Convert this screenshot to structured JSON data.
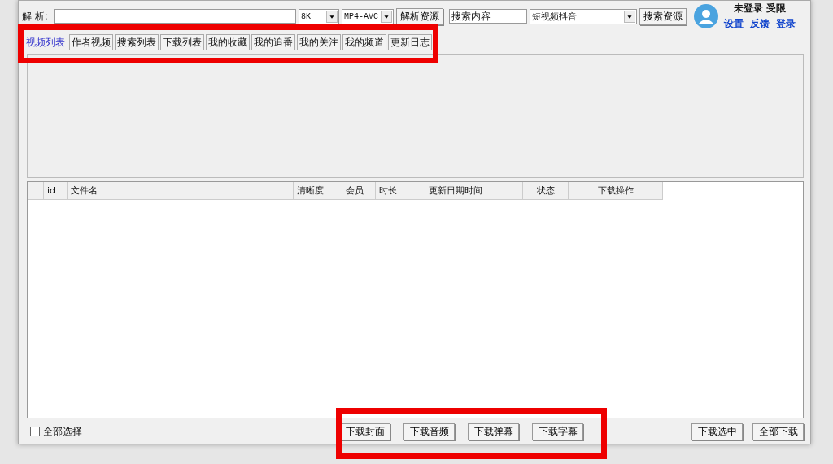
{
  "toolbar": {
    "parse_label": "解 析:",
    "quality": "8K",
    "format": "MP4-AVC",
    "parse_button": "解析资源",
    "search_value": "搜索内容",
    "platform": "短视频抖音",
    "search_button": "搜索资源"
  },
  "account": {
    "status": "未登录 受限",
    "links": [
      "设置",
      "反馈",
      "登录"
    ]
  },
  "tabs": [
    {
      "label": "视频列表",
      "selected": true
    },
    {
      "label": "作者视频",
      "selected": false
    },
    {
      "label": "搜索列表",
      "selected": false
    },
    {
      "label": "下载列表",
      "selected": false
    },
    {
      "label": "我的收藏",
      "selected": false
    },
    {
      "label": "我的追番",
      "selected": false
    },
    {
      "label": "我的关注",
      "selected": false
    },
    {
      "label": "我的频道",
      "selected": false
    },
    {
      "label": "更新日志",
      "selected": false
    }
  ],
  "table": {
    "columns": [
      "id",
      "文件名",
      "清晰度",
      "会员",
      "时长",
      "更新日期时间",
      "状态",
      "下载操作"
    ]
  },
  "footer": {
    "select_all": {
      "label": "全部选择",
      "checked": false
    },
    "middle_buttons": [
      "下载封面",
      "下载音频",
      "下载弹幕",
      "下载字幕"
    ],
    "right_buttons": [
      "下载选中",
      "全部下载"
    ]
  }
}
